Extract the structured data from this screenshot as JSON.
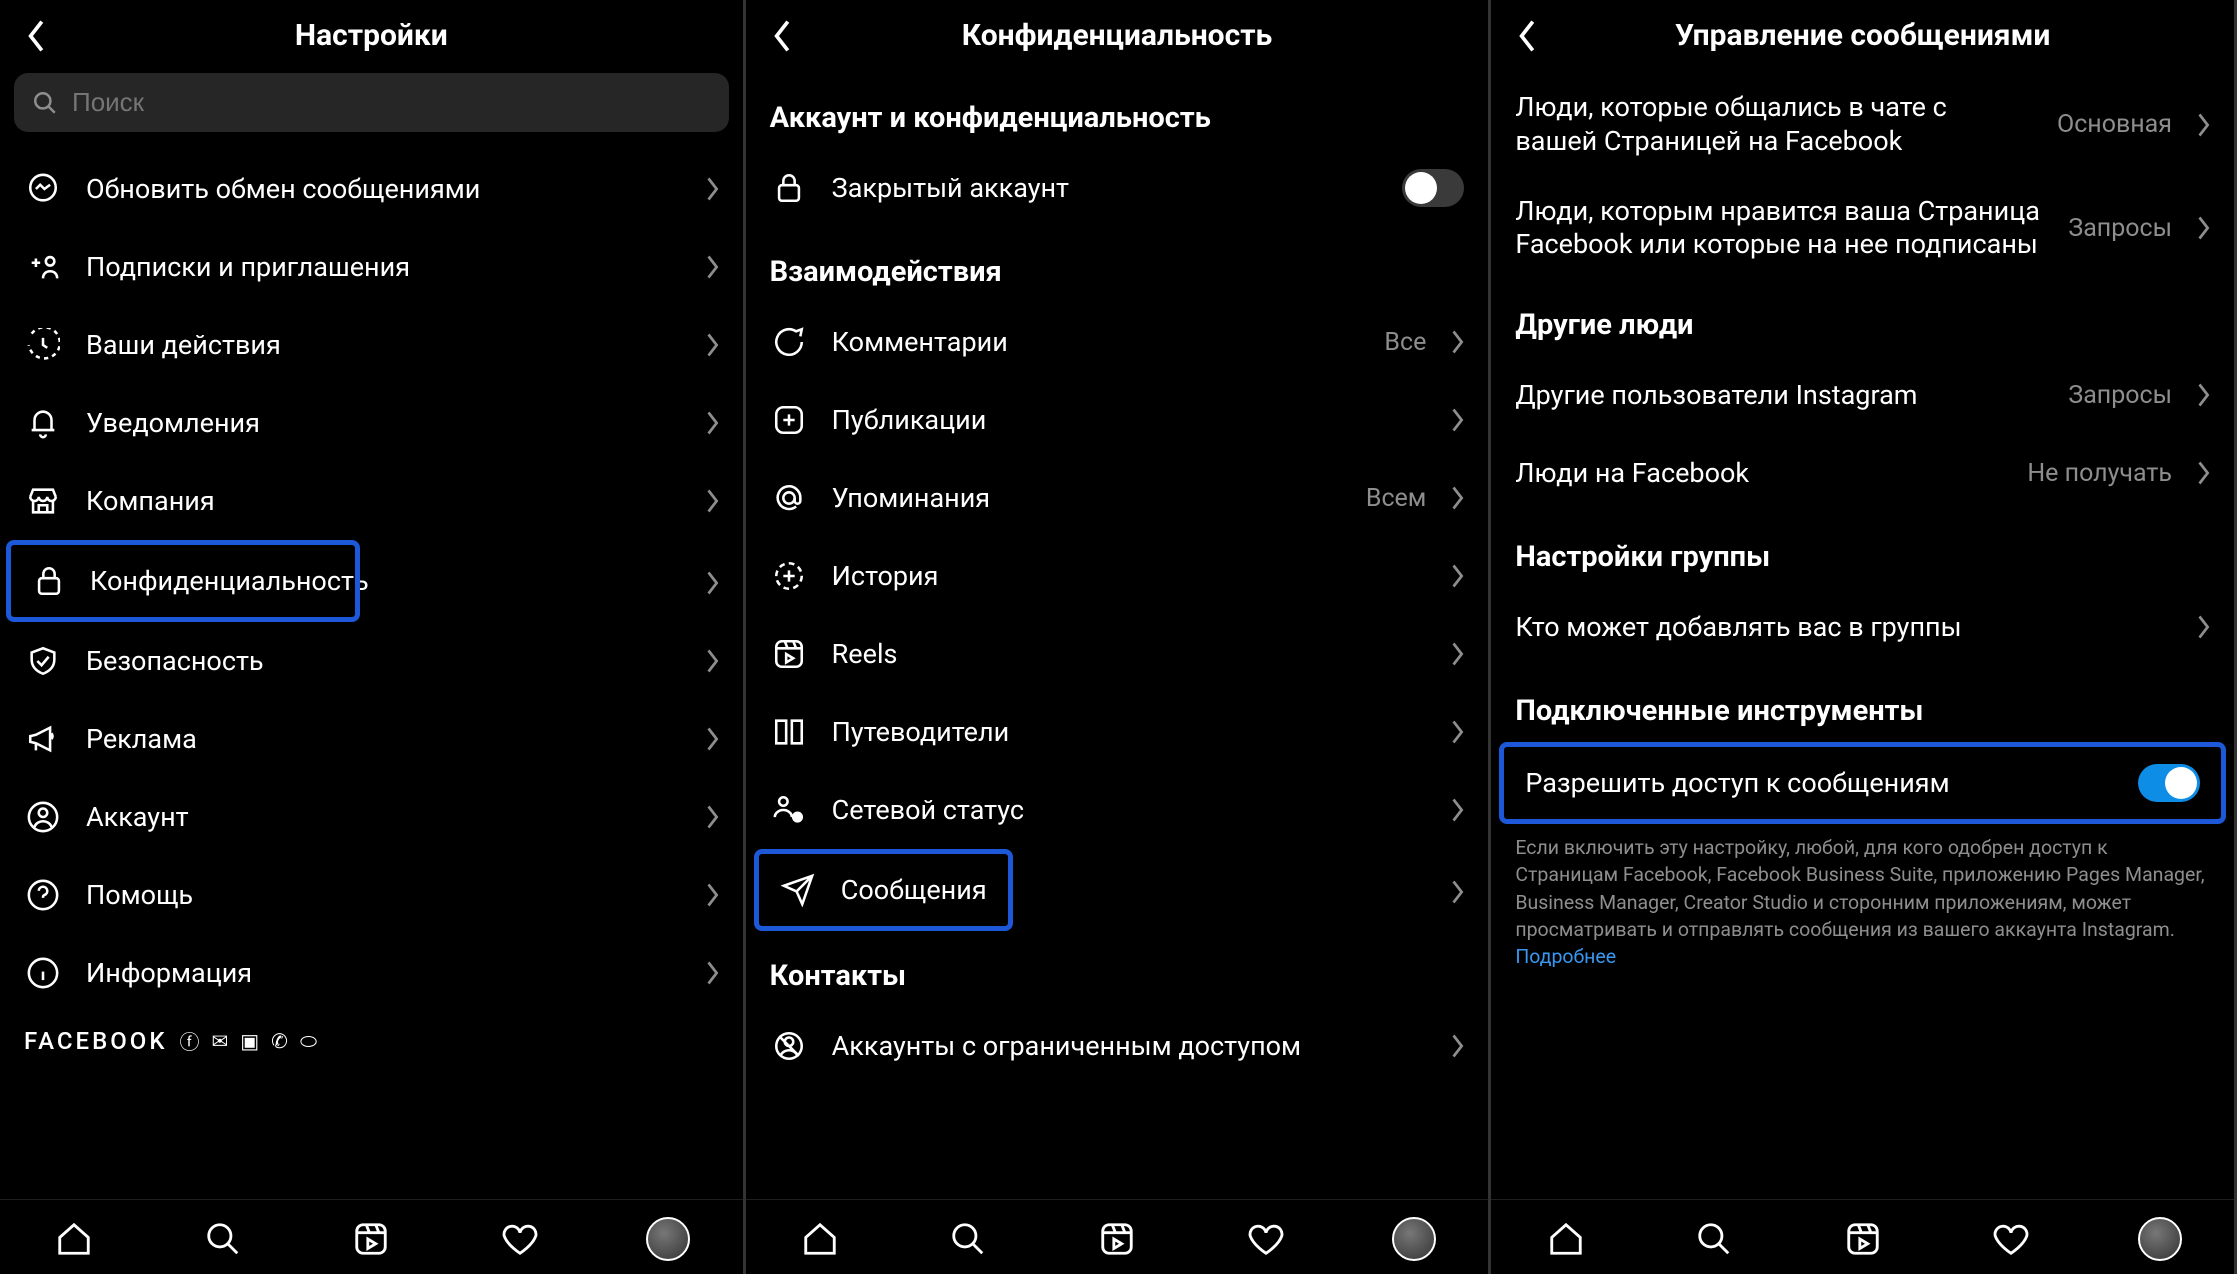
{
  "phones": {
    "settings": {
      "title": "Настройки",
      "search_placeholder": "Поиск",
      "items": [
        {
          "label": "Обновить обмен сообщениями"
        },
        {
          "label": "Подписки и приглашения"
        },
        {
          "label": "Ваши действия"
        },
        {
          "label": "Уведомления"
        },
        {
          "label": "Компания"
        },
        {
          "label": "Конфиденциальность"
        },
        {
          "label": "Безопасность"
        },
        {
          "label": "Реклама"
        },
        {
          "label": "Аккаунт"
        },
        {
          "label": "Помощь"
        },
        {
          "label": "Информация"
        }
      ],
      "facebook": "FACEBOOK"
    },
    "privacy": {
      "title": "Конфиденциальность",
      "section_account": "Аккаунт и конфиденциальность",
      "private_account": "Закрытый аккаунт",
      "section_interactions": "Взаимодействия",
      "items": [
        {
          "label": "Комментарии",
          "value": "Все"
        },
        {
          "label": "Публикации"
        },
        {
          "label": "Упоминания",
          "value": "Всем"
        },
        {
          "label": "История"
        },
        {
          "label": "Reels"
        },
        {
          "label": "Путеводители"
        },
        {
          "label": "Сетевой статус"
        },
        {
          "label": "Сообщения"
        }
      ],
      "section_contacts": "Контакты",
      "restricted": "Аккаунты с ограниченным доступом"
    },
    "messages": {
      "title": "Управление сообщениями",
      "potential": [
        {
          "label": "Люди, которые общались в чате с вашей Страницей на Facebook",
          "value": "Основная"
        },
        {
          "label": "Люди, которым нравится ваша Страница Facebook или которые на нее подписаны",
          "value": "Запросы"
        }
      ],
      "section_others": "Другие люди",
      "others": [
        {
          "label": "Другие пользователи Instagram",
          "value": "Запросы"
        },
        {
          "label": "Люди на Facebook",
          "value": "Не получать"
        }
      ],
      "section_group": "Настройки группы",
      "group_add": "Кто может добавлять вас в группы",
      "section_tools": "Подключенные инструменты",
      "allow_access": "Разрешить доступ к сообщениям",
      "helper_text": "Если включить эту настройку, любой, для кого одобрен доступ к Страницам Facebook, Facebook Business Suite, приложению Pages Manager, Business Manager, Creator Studio и сторонним приложениям, может просматривать и отправлять сообщения из вашего аккаунта Instagram.",
      "helper_link": "Подробнее"
    }
  }
}
